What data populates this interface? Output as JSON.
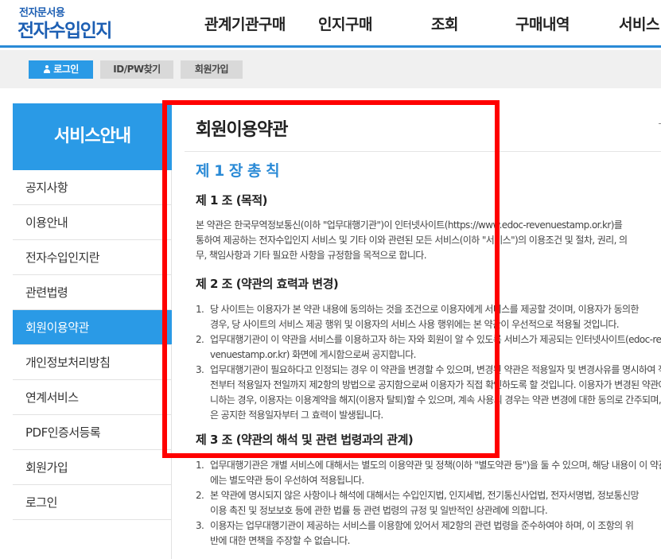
{
  "header": {
    "logo_top": "전자문서용",
    "logo_main": "전자수입인지",
    "nav": [
      "관계기관구매",
      "인지구매",
      "조회",
      "구매내역",
      "서비스"
    ]
  },
  "utilbar": {
    "login": "로그인",
    "find_id": "ID/PW찾기",
    "join": "회원가입"
  },
  "sidebar": {
    "title": "서비스안내",
    "items": [
      {
        "label": "공지사항"
      },
      {
        "label": "이용안내"
      },
      {
        "label": "전자수입인지란"
      },
      {
        "label": "관련법령"
      },
      {
        "label": "회원이용약관",
        "active": true
      },
      {
        "label": "개인정보처리방침"
      },
      {
        "label": "연계서비스"
      },
      {
        "label": "PDF인증서등록"
      },
      {
        "label": "회원가입"
      },
      {
        "label": "로그인"
      }
    ]
  },
  "content": {
    "page_title": "회원이용약관",
    "chapter1": "제 1 장 총 칙",
    "article1": {
      "title": "제 1 조 (목적)",
      "lines": [
        "본 약관은 한국무역정보통신(이하 \"업무대행기관\")이 인터넷사이트(https://www.edoc-revenuestamp.or.kr)를",
        "통하여 제공하는 전자수입인지 서비스 및 기타 이와 관련된 모든 서비스(이하 \"서비스\")의 이용조건 및 절차, 권리, 의",
        "무, 책임사항과 기타 필요한 사항을 규정함을 목적으로 합니다."
      ]
    },
    "article2": {
      "title": "제 2 조 (약관의 효력과 변경)",
      "items": [
        {
          "num": "1.",
          "lines": [
            "당 사이트는 이용자가 본 약관 내용에 동의하는 것을 조건으로 이용자에게 서비스를 제공할 것이며, 이용자가 동의한",
            "경우, 당 사이트의 서비스 제공 행위 및 이용자의 서비스 사용 행위에는 본 약관이 우선적으로 적용될 것입니다."
          ]
        },
        {
          "num": "2.",
          "lines": [
            "업무대행기관이 이 약관을 서비스를 이용하고자 하는 자와 회원이 알 수 있도록 서비스가 제공되는 인터넷사이트(edoc-re",
            "venuestamp.or.kr) 화면에 게시함으로써 공지합니다."
          ]
        },
        {
          "num": "3.",
          "lines": [
            "업무대행기관이 필요하다고 인정되는 경우 이 약관을 변경할 수 있으며, 변경된 약관은 적용일자 및 변경사유를 명시하여 적용일자 7일",
            "전부터 적용일자 전일까지 제2항의 방법으로 공지함으로써 이용자가 직접 확인하도록 할 것입니다. 이용자가 변경된 약관에 동의하지 아",
            "니하는 경우, 이용자는 이용계약을 해지(이용자 탈퇴)할 수 있으며, 계속 사용의 경우는 약관 변경에 대한 동의로 간주되며, 변경된 약관",
            "은 공지한 적용일자부터 그 효력이 발생됩니다."
          ]
        }
      ]
    },
    "article3": {
      "title": "제 3 조 (약관의 해석 및 관련 법령과의 관계)",
      "items": [
        {
          "num": "1.",
          "lines": [
            "업무대행기관은 개별 서비스에 대해서는 별도의 이용약관 및 정책(이하 \"별도약관 등\")을 둘 수 있으며, 해당 내용이 이 약관과 상충할 경우",
            "에는 별도약관 등이 우선하여 적용됩니다."
          ]
        },
        {
          "num": "2.",
          "lines": [
            "본 약관에 명시되지 않은 사항이나 해석에 대해서는 수입인지법, 인지세법, 전기통신사업법, 전자서명법, 정보통신망",
            "이용 촉진 및 정보보호 등에 관한 법률 등 관련 법령의 규정 및 일반적인 상관례에 의합니다."
          ]
        },
        {
          "num": "3.",
          "lines": [
            "이용자는 업무대행기관이 제공하는 서비스를 이용함에 있어서 제2항의 관련 법령을 준수하여야 하며, 이 조항의 위",
            "반에 대한 면책을 주장할 수 없습니다."
          ]
        }
      ]
    }
  },
  "colors": {
    "brand_blue": "#2a9ae6",
    "logo_blue": "#1d5fb3",
    "highlight_red": "#ff0000"
  }
}
